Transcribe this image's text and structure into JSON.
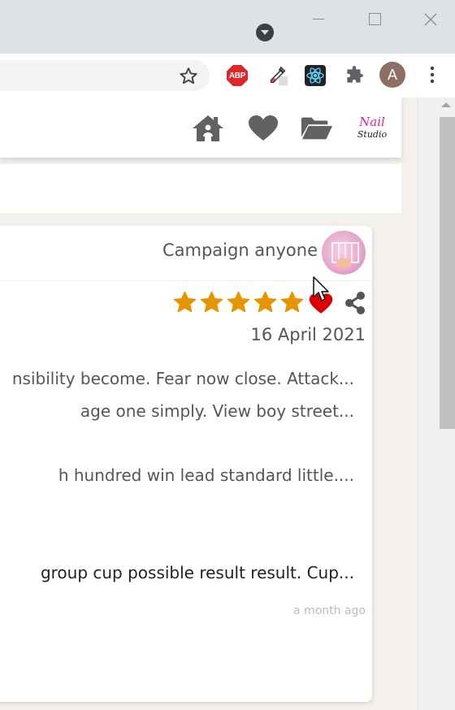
{
  "browser": {
    "extensions": {
      "adblock_label": "ABP"
    },
    "profile_initial": "A",
    "icons": [
      "tab-dropdown-icon",
      "minimize-icon",
      "maximize-icon",
      "close-icon",
      "bookmark-star-icon",
      "eyedropper-icon",
      "react-devtools-icon",
      "puzzle-icon",
      "kebab-menu-icon"
    ]
  },
  "header": {
    "icons": [
      "home-icon",
      "heart-icon",
      "folder-open-icon",
      "nail-studio-logo"
    ],
    "logo_text_top": "Nail",
    "logo_text_bottom": "Studio"
  },
  "review": {
    "author": "Campaign anyone",
    "rating": 5,
    "rating_max": 5,
    "date": "16 April 2021",
    "snippets": [
      "nsibility become. Fear now close. Attack...",
      "age one simply. View boy street...",
      "h hundred win lead standard little....",
      "group cup possible result result. Cup..."
    ],
    "relative_time": "a month ago"
  },
  "colors": {
    "star": "#e69500",
    "heart": "#e00000",
    "header_icon": "#616161",
    "logo_pink": "#e6248f"
  }
}
